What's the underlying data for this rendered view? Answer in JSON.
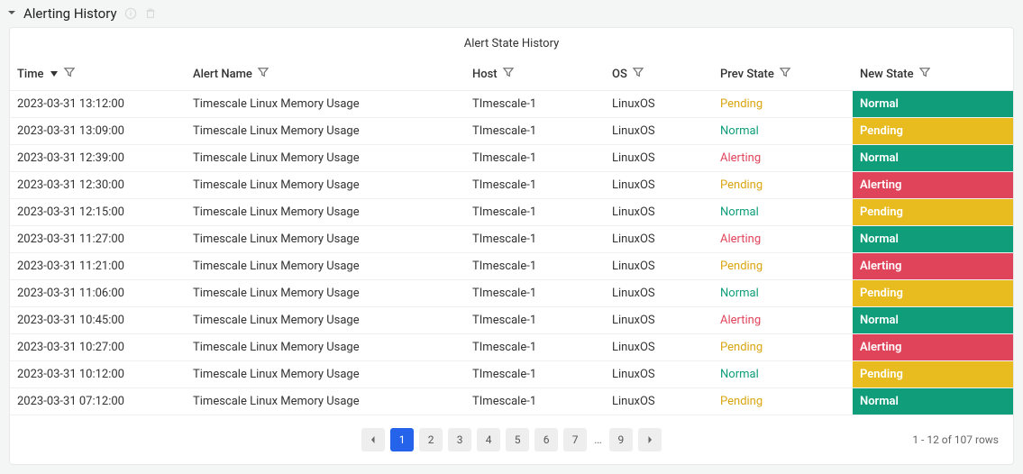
{
  "panel": {
    "title": "Alerting History",
    "table_title": "Alert State History"
  },
  "columns": {
    "time": "Time",
    "alert": "Alert Name",
    "host": "Host",
    "os": "OS",
    "prev": "Prev State",
    "new": "New State"
  },
  "rows": [
    {
      "time": "2023-03-31 13:12:00",
      "alert": "Timescale Linux Memory Usage",
      "host": "TImescale-1",
      "os": "LinuxOS",
      "prev": "Pending",
      "new": "Normal"
    },
    {
      "time": "2023-03-31 13:09:00",
      "alert": "Timescale Linux Memory Usage",
      "host": "TImescale-1",
      "os": "LinuxOS",
      "prev": "Normal",
      "new": "Pending"
    },
    {
      "time": "2023-03-31 12:39:00",
      "alert": "Timescale Linux Memory Usage",
      "host": "TImescale-1",
      "os": "LinuxOS",
      "prev": "Alerting",
      "new": "Normal"
    },
    {
      "time": "2023-03-31 12:30:00",
      "alert": "Timescale Linux Memory Usage",
      "host": "TImescale-1",
      "os": "LinuxOS",
      "prev": "Pending",
      "new": "Alerting"
    },
    {
      "time": "2023-03-31 12:15:00",
      "alert": "Timescale Linux Memory Usage",
      "host": "TImescale-1",
      "os": "LinuxOS",
      "prev": "Normal",
      "new": "Pending"
    },
    {
      "time": "2023-03-31 11:27:00",
      "alert": "Timescale Linux Memory Usage",
      "host": "TImescale-1",
      "os": "LinuxOS",
      "prev": "Alerting",
      "new": "Normal"
    },
    {
      "time": "2023-03-31 11:21:00",
      "alert": "Timescale Linux Memory Usage",
      "host": "TImescale-1",
      "os": "LinuxOS",
      "prev": "Pending",
      "new": "Alerting"
    },
    {
      "time": "2023-03-31 11:06:00",
      "alert": "Timescale Linux Memory Usage",
      "host": "TImescale-1",
      "os": "LinuxOS",
      "prev": "Normal",
      "new": "Pending"
    },
    {
      "time": "2023-03-31 10:45:00",
      "alert": "Timescale Linux Memory Usage",
      "host": "TImescale-1",
      "os": "LinuxOS",
      "prev": "Alerting",
      "new": "Normal"
    },
    {
      "time": "2023-03-31 10:27:00",
      "alert": "Timescale Linux Memory Usage",
      "host": "TImescale-1",
      "os": "LinuxOS",
      "prev": "Pending",
      "new": "Alerting"
    },
    {
      "time": "2023-03-31 10:12:00",
      "alert": "Timescale Linux Memory Usage",
      "host": "TImescale-1",
      "os": "LinuxOS",
      "prev": "Normal",
      "new": "Pending"
    },
    {
      "time": "2023-03-31 07:12:00",
      "alert": "Timescale Linux Memory Usage",
      "host": "TImescale-1",
      "os": "LinuxOS",
      "prev": "Pending",
      "new": "Normal"
    }
  ],
  "pager": {
    "pages": [
      "1",
      "2",
      "3",
      "4",
      "5",
      "6",
      "7"
    ],
    "last": "9",
    "active": "1",
    "count_text": "1 - 12 of 107 rows"
  }
}
